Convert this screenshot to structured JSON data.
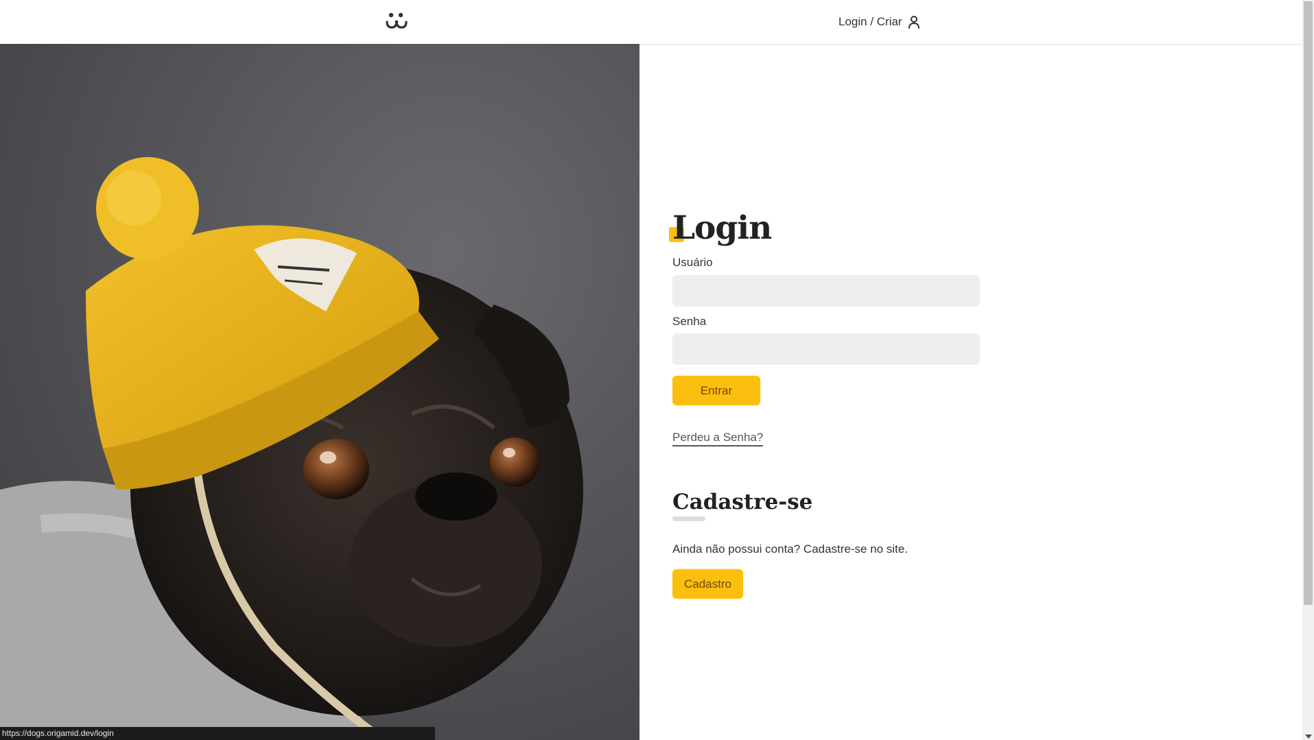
{
  "header": {
    "logo_icon": "dog-face-icon",
    "login_label": "Login / Criar",
    "user_icon": "user-icon"
  },
  "login": {
    "title": "Login",
    "username_label": "Usuário",
    "username_value": "",
    "password_label": "Senha",
    "password_value": "",
    "submit_label": "Entrar",
    "lost_password_label": "Perdeu a Senha?"
  },
  "signup": {
    "title": "Cadastre-se",
    "description": "Ainda não possui conta? Cadastre-se no site.",
    "button_label": "Cadastro"
  },
  "status_bar": {
    "url": "https://dogs.origamid.dev/login"
  },
  "colors": {
    "accent": "#fbbf0f",
    "accent_text": "#764701",
    "input_bg": "#eeeeee"
  }
}
